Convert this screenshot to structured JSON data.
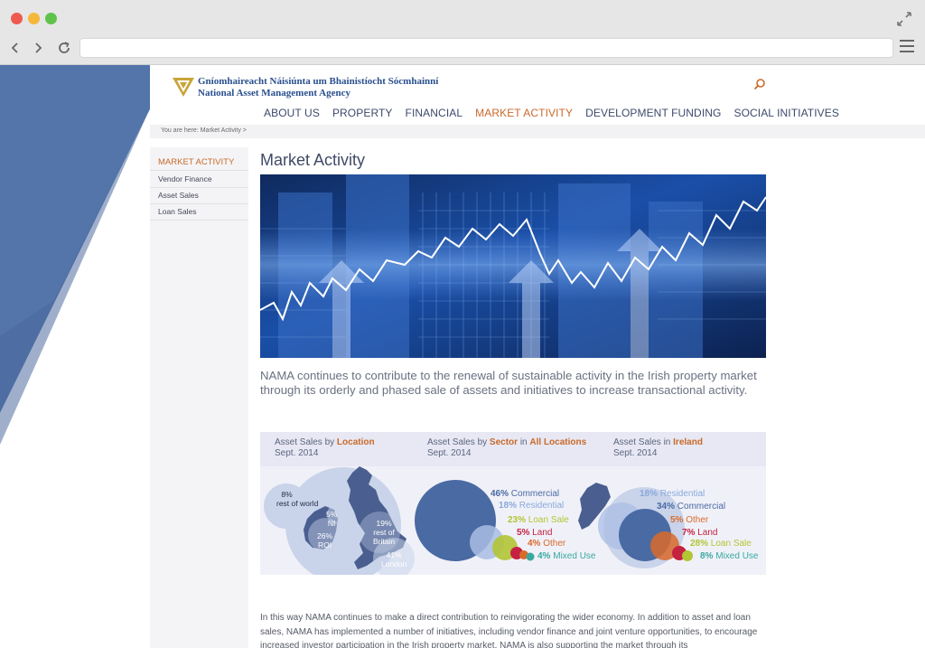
{
  "agency": {
    "name_irish": "Gníomhaireacht Náisiúnta um Bhainistíocht Sócmhainní",
    "name_english": "National Asset Management Agency"
  },
  "nav": [
    {
      "label": "ABOUT US",
      "active": false
    },
    {
      "label": "PROPERTY",
      "active": false
    },
    {
      "label": "FINANCIAL",
      "active": false
    },
    {
      "label": "MARKET ACTIVITY",
      "active": true
    },
    {
      "label": "DEVELOPMENT FUNDING",
      "active": false
    },
    {
      "label": "SOCIAL INITIATIVES",
      "active": false
    }
  ],
  "breadcrumb": "You are here: Market Activity >",
  "sidebar": {
    "heading": "MARKET ACTIVITY",
    "items": [
      "Vendor Finance",
      "Asset Sales",
      "Loan Sales"
    ]
  },
  "page_title": "Market Activity",
  "lead": "NAMA continues to contribute to the renewal of sustainable activity in the Irish property market through its orderly and phased sale of assets and initiatives to increase transactional activity.",
  "infographic": {
    "panels": [
      {
        "prefix": "Asset Sales by ",
        "highlight": "Location",
        "middle": "",
        "highlight2": "",
        "date": "Sept. 2014"
      },
      {
        "prefix": "Asset Sales by ",
        "highlight": "Sector",
        "middle": " in ",
        "highlight2": "All Locations",
        "date": "Sept. 2014"
      },
      {
        "prefix": "Asset Sales in ",
        "highlight": "Ireland",
        "middle": "",
        "highlight2": "",
        "date": "Sept. 2014"
      }
    ],
    "location": [
      {
        "pct": "8%",
        "label": "rest of world"
      },
      {
        "pct": "5%",
        "label": "NI"
      },
      {
        "pct": "26%",
        "label": "ROI"
      },
      {
        "pct": "19%",
        "label": "rest of Britain"
      },
      {
        "pct": "41%",
        "label": "London"
      }
    ],
    "sector_all": [
      {
        "pct": "46%",
        "label": "Commercial",
        "color": "#4a6aa3"
      },
      {
        "pct": "18%",
        "label": "Residential",
        "color": "#8aa8dc"
      },
      {
        "pct": "23%",
        "label": "Loan Sale",
        "color": "#b3c434"
      },
      {
        "pct": "5%",
        "label": "Land",
        "color": "#c52141"
      },
      {
        "pct": "4%",
        "label": "Other",
        "color": "#d96a2a"
      },
      {
        "pct": "4%",
        "label": "Mixed Use",
        "color": "#3aa8a0"
      }
    ],
    "sector_ireland": [
      {
        "pct": "18%",
        "label": "Residential",
        "color": "#8aa8dc"
      },
      {
        "pct": "34%",
        "label": "Commercial",
        "color": "#4a6aa3"
      },
      {
        "pct": "5%",
        "label": "Other",
        "color": "#d96a2a"
      },
      {
        "pct": "7%",
        "label": "Land",
        "color": "#c52141"
      },
      {
        "pct": "28%",
        "label": "Loan Sale",
        "color": "#b3c434"
      },
      {
        "pct": "8%",
        "label": "Mixed Use",
        "color": "#3aa8a0"
      }
    ]
  },
  "body_text": "In this way NAMA continues to make a direct contribution to reinvigorating the wider economy. In addition to asset and loan sales, NAMA has implemented a number of initiatives, including vendor finance and joint venture opportunities, to encourage increased investor participation in the Irish property market. NAMA is also supporting the market through its",
  "colors": {
    "accent": "#c9692a",
    "brand_blue": "#2a4f8f",
    "deco_blue": "#3f5f98"
  }
}
